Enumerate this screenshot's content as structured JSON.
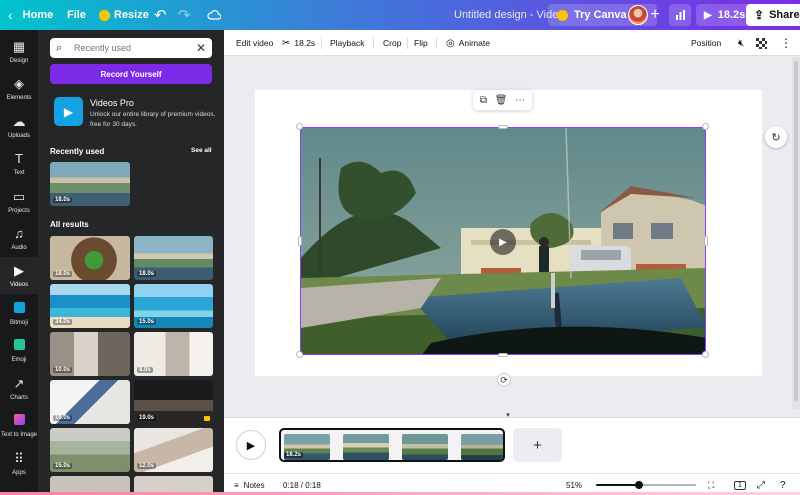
{
  "topbar": {
    "home": "Home",
    "file": "File",
    "resize": "Resize",
    "title": "Untitled design - Video",
    "try_pro": "Try Canva Pro",
    "play_time": "18.2s",
    "share": "Share"
  },
  "rail": {
    "items": [
      {
        "label": "Design",
        "icon": "▦"
      },
      {
        "label": "Elements",
        "icon": "◈"
      },
      {
        "label": "Uploads",
        "icon": "☁"
      },
      {
        "label": "Text",
        "icon": "T"
      },
      {
        "label": "Projects",
        "icon": "▭"
      },
      {
        "label": "Audio",
        "icon": "♫"
      },
      {
        "label": "Videos",
        "icon": "▶"
      },
      {
        "label": "Bitmoji",
        "icon": ""
      },
      {
        "label": "Emoji",
        "icon": ""
      },
      {
        "label": "Charts",
        "icon": "↗"
      },
      {
        "label": "Text to Image",
        "icon": "✦"
      },
      {
        "label": "Apps",
        "icon": "⠿"
      }
    ],
    "active": "Videos"
  },
  "panel": {
    "search_placeholder": "Recently used",
    "record_button": "Record Yourself",
    "promo_title": "Videos Pro",
    "promo_text": "Unlock our entire library of premium videos, free for 30 days.",
    "recent_heading": "Recently used",
    "see_all": "See all",
    "recent_duration": "18.0s",
    "all_results_heading": "All results",
    "results": [
      {
        "duration": "18.0s"
      },
      {
        "duration": "18.0s"
      },
      {
        "duration": "34.0s"
      },
      {
        "duration": "15.0s"
      },
      {
        "duration": "10.0s"
      },
      {
        "duration": "8.0s"
      },
      {
        "duration": "19.0s"
      },
      {
        "duration": "19.0s"
      },
      {
        "duration": "15.0s"
      },
      {
        "duration": "12.0s"
      }
    ]
  },
  "toolbar": {
    "edit_video": "Edit video",
    "duration": "18.2s",
    "playback": "Playback",
    "crop": "Crop",
    "flip": "Flip",
    "animate": "Animate",
    "position": "Position"
  },
  "timeline": {
    "strip_duration": "18.2s"
  },
  "footer": {
    "notes": "Notes",
    "time": "0:18 / 0:18",
    "zoom": "51%",
    "zoom_level": 0.43,
    "page_number": "1"
  },
  "colors": {
    "accent": "#7d2ae8",
    "panel_bg": "#252627",
    "rail_bg": "#18191b"
  }
}
